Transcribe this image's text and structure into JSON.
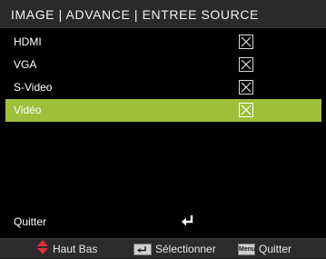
{
  "menu": {
    "title": "IMAGE | ADVANCE | ENTREE SOURCE",
    "items": [
      {
        "label": "HDMI",
        "checked": true
      },
      {
        "label": "VGA",
        "checked": true
      },
      {
        "label": "S-Video",
        "checked": true
      },
      {
        "label": "Vidéo",
        "checked": true
      }
    ],
    "selected_index": 3,
    "exit_label": "Quitter",
    "exit_icon": "enter-arrow-icon"
  },
  "footer": {
    "nav_icon": "up-down-arrows-icon",
    "nav_label": "Haut Bas",
    "select_icon": "enter-key-icon",
    "select_label": "Sélectionner",
    "menu_key_label": "Menu",
    "menu_label": "Quitter"
  },
  "colors": {
    "highlight": "#9fbe3a",
    "nav_arrow": "#e0303a",
    "background": "#000000"
  }
}
